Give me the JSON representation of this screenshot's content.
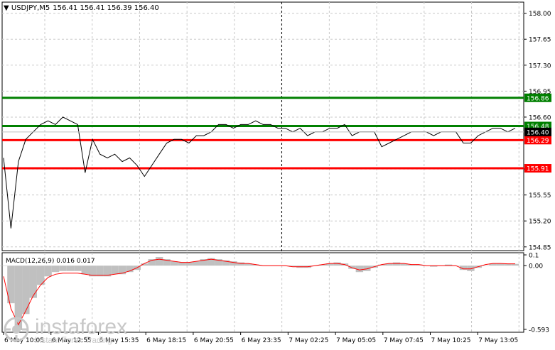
{
  "header": {
    "symbol": "USDJPY,M5",
    "ohlc": "156.41 156.41 156.39 156.40"
  },
  "macd": {
    "label": "MACD(12,26,9) 0.016 0.017"
  },
  "logo": {
    "name": "instaforex",
    "tagline": "Instant Forex Trading"
  },
  "colors": {
    "price_line": "#000000",
    "resistance_line": "#008000",
    "support_line": "#ff0000",
    "macd_hist": "#c0c0c0",
    "signal_line": "#ff0000",
    "grid": "#c8c8c8"
  },
  "chart_data": [
    {
      "type": "line",
      "title": "USDJPY,M5",
      "ylim": [
        154.8,
        158.15
      ],
      "y_ticks": [
        "158.00",
        "157.65",
        "157.30",
        "156.95",
        "156.60",
        "155.90",
        "155.55",
        "155.20",
        "154.85"
      ],
      "x_ticks": [
        "6 May 10:05",
        "6 May 12:55",
        "6 May 15:35",
        "6 May 18:15",
        "6 May 20:55",
        "6 May 23:35",
        "7 May 02:25",
        "7 May 05:05",
        "7 May 07:45",
        "7 May 10:25",
        "7 May 13:05"
      ],
      "series": [
        {
          "values": [
            156.05,
            155.1,
            156.0,
            156.3,
            156.4,
            156.5,
            156.55,
            156.5,
            156.6,
            156.55,
            156.5,
            155.85,
            156.3,
            156.1,
            156.05,
            156.1,
            156.0,
            156.05,
            155.95,
            155.8,
            155.95,
            156.1,
            156.25,
            156.3,
            156.3,
            156.25,
            156.35,
            156.35,
            156.4,
            156.5,
            156.5,
            156.45,
            156.5,
            156.5,
            156.55,
            156.5,
            156.5,
            156.45,
            156.45,
            156.4,
            156.45,
            156.35,
            156.4,
            156.4,
            156.45,
            156.45,
            156.5,
            156.35,
            156.4,
            156.4,
            156.4,
            156.2,
            156.25,
            156.3,
            156.35,
            156.4,
            156.4,
            156.4,
            156.35,
            156.4,
            156.4,
            156.4,
            156.25,
            156.25,
            156.35,
            156.4,
            156.45,
            156.45,
            156.4,
            156.45
          ]
        }
      ],
      "levels": [
        {
          "value": 156.86,
          "label": "156.86",
          "color": "#008000"
        },
        {
          "value": 156.48,
          "label": "156.48",
          "color": "#008000"
        },
        {
          "value": 156.29,
          "label": "156.29",
          "color": "#ff0000"
        },
        {
          "value": 155.91,
          "label": "155.91",
          "color": "#ff0000"
        }
      ],
      "current": {
        "value": 156.4,
        "label": "156.40"
      },
      "grid": true
    },
    {
      "type": "bar",
      "title": "MACD(12,26,9) 0.016 0.017",
      "ylim": [
        -0.62,
        0.12
      ],
      "y_ticks": [
        "0.1",
        "0.00",
        "-0.593"
      ],
      "series": [
        {
          "name": "MACD",
          "values": [
            0.0,
            -0.35,
            -0.6,
            -0.45,
            -0.3,
            -0.18,
            -0.1,
            -0.06,
            -0.05,
            -0.05,
            -0.05,
            -0.08,
            -0.1,
            -0.1,
            -0.1,
            -0.08,
            -0.08,
            -0.06,
            -0.04,
            0.02,
            0.06,
            0.08,
            0.06,
            0.04,
            0.03,
            0.03,
            0.04,
            0.06,
            0.07,
            0.06,
            0.05,
            0.04,
            0.03,
            0.02,
            0.01,
            0.0,
            0.0,
            0.0,
            0.0,
            -0.01,
            -0.02,
            -0.02,
            0.0,
            0.01,
            0.02,
            0.03,
            0.02,
            -0.03,
            -0.06,
            -0.05,
            -0.02,
            0.01,
            0.02,
            0.03,
            0.02,
            0.01,
            0.01,
            0.0,
            -0.01,
            0.0,
            0.01,
            0.0,
            -0.04,
            -0.05,
            -0.02,
            0.0,
            0.02,
            0.02,
            0.016,
            0.016
          ]
        },
        {
          "name": "Signal",
          "values": [
            -0.1,
            -0.4,
            -0.55,
            -0.42,
            -0.28,
            -0.18,
            -0.11,
            -0.08,
            -0.07,
            -0.07,
            -0.07,
            -0.08,
            -0.09,
            -0.09,
            -0.09,
            -0.08,
            -0.07,
            -0.05,
            -0.02,
            0.02,
            0.05,
            0.06,
            0.05,
            0.04,
            0.03,
            0.03,
            0.04,
            0.05,
            0.06,
            0.05,
            0.04,
            0.03,
            0.02,
            0.02,
            0.01,
            0.0,
            0.0,
            0.0,
            0.0,
            -0.01,
            -0.01,
            -0.01,
            0.0,
            0.01,
            0.02,
            0.02,
            0.01,
            -0.02,
            -0.04,
            -0.03,
            -0.01,
            0.01,
            0.02,
            0.02,
            0.02,
            0.01,
            0.01,
            0.0,
            0.0,
            0.0,
            0.0,
            0.0,
            -0.03,
            -0.03,
            -0.01,
            0.01,
            0.02,
            0.02,
            0.017,
            0.017
          ]
        }
      ]
    }
  ]
}
